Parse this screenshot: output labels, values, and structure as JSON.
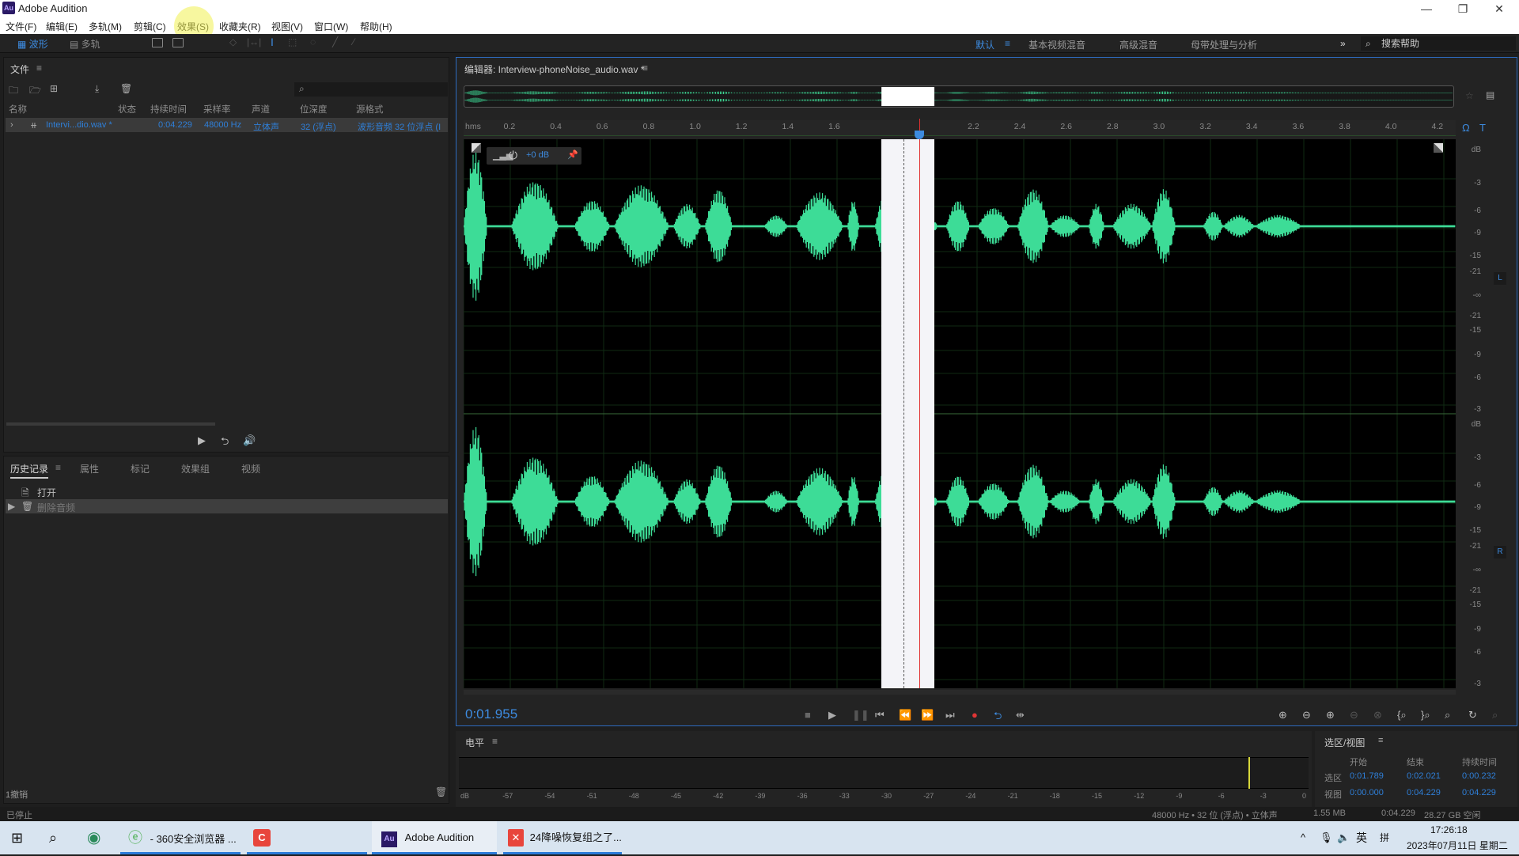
{
  "window": {
    "app_title": "Adobe Audition",
    "logo": "Au",
    "minimize": "—",
    "restore": "❐",
    "close": "✕"
  },
  "menu": [
    "文件(F)",
    "编辑(E)",
    "多轨(M)",
    "剪辑(C)",
    "效果(S)",
    "收藏夹(R)",
    "视图(V)",
    "窗口(W)",
    "帮助(H)"
  ],
  "toolbar": {
    "waveform_label": "波形",
    "multitrack_label": "多轨"
  },
  "workspaces": {
    "active": "默认",
    "items": [
      "基本视频混音",
      "高级混音",
      "母带处理与分析"
    ],
    "more": "»",
    "search_placeholder": "搜索帮助"
  },
  "files_panel": {
    "title": "文件",
    "columns": [
      "名称",
      "状态",
      "持续时间",
      "采样率",
      "声道",
      "位深度",
      "源格式"
    ],
    "rows": [
      {
        "name": "Intervi...dio.wav *",
        "status": "",
        "duration": "0:04.229",
        "sample_rate": "48000 Hz",
        "channels": "立体声",
        "bit_depth": "32 (浮点)",
        "format": "波形音频 32 位浮点 (I"
      }
    ]
  },
  "history_panel": {
    "tabs": [
      "历史记录",
      "属性",
      "标记",
      "效果组",
      "视频"
    ],
    "items": [
      "打开",
      "删除音频"
    ],
    "undo_count": "1撤销"
  },
  "editor": {
    "title": "编辑器: Interview-phoneNoise_audio.wav *",
    "ruler_unit": "hms",
    "ruler_ticks": [
      "0.2",
      "0.4",
      "0.6",
      "0.8",
      "1.0",
      "1.2",
      "1.4",
      "1.6",
      "2.2",
      "2.4",
      "2.6",
      "2.8",
      "3.0",
      "3.2",
      "3.4",
      "3.6",
      "3.8",
      "4.0",
      "4.2"
    ],
    "gain": "+0 dB",
    "db_labels": [
      "dB",
      "-3",
      "-6",
      "-9",
      "-15",
      "-21",
      "-∞",
      "-21",
      "-15",
      "-9",
      "-6",
      "-3"
    ],
    "channel_left": "L",
    "channel_right": "R",
    "current_time": "0:01.955"
  },
  "levels_panel": {
    "title": "电平",
    "scale": [
      "dB",
      "-57",
      "-54",
      "-51",
      "-48",
      "-45",
      "-42",
      "-39",
      "-36",
      "-33",
      "-30",
      "-27",
      "-24",
      "-21",
      "-18",
      "-15",
      "-12",
      "-9",
      "-6",
      "-3",
      "0"
    ]
  },
  "selection_view": {
    "title": "选区/视图",
    "headers": [
      "开始",
      "结束",
      "持续时间"
    ],
    "selection": {
      "label": "选区",
      "start": "0:01.789",
      "end": "0:02.021",
      "duration": "0:00.232"
    },
    "view": {
      "label": "视图",
      "start": "0:00.000",
      "end": "0:04.229",
      "duration": "0:04.229"
    }
  },
  "status": {
    "state": "已停止",
    "format": "48000 Hz • 32 位 (浮点) • 立体声",
    "size": "1.55 MB",
    "duration": "0:04.229",
    "free": "28.27 GB 空闲"
  },
  "taskbar": {
    "items": [
      "- 360安全浏览器 ...",
      "Adobe Audition",
      "24降噪恢复组之了..."
    ],
    "tray_lang": "英",
    "tray_ime": "拼",
    "time": "17:26:18",
    "date": "2023年07月11日 星期二"
  },
  "colors": {
    "accent": "#2f7fd8",
    "waveform": "#3ddc97",
    "playhead": "#e03030",
    "editor_border": "#2d6bbf"
  }
}
